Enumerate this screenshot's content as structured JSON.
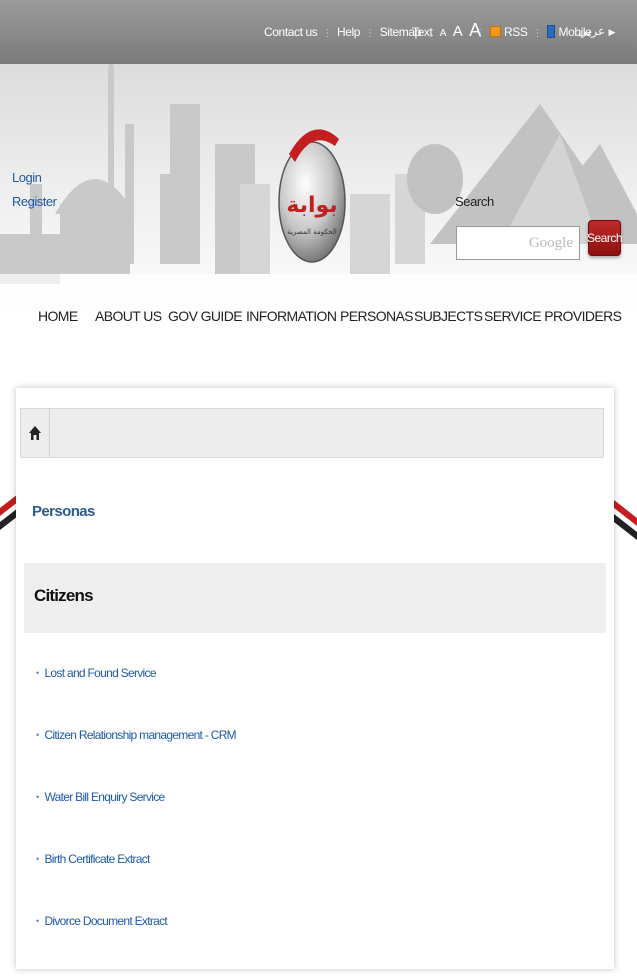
{
  "topbar": {
    "contact": "Contact us",
    "help": "Help",
    "sitemap": "Sitemap",
    "text_label": "Text",
    "text_sizes": [
      "A",
      "A",
      "A"
    ],
    "rss": "RSS",
    "mobile": "Mobile",
    "arabic": "عربي"
  },
  "header": {
    "login": "Login",
    "register": "Register",
    "logo_text": "بوابة",
    "logo_sub": "الحكومة المصرية",
    "search_label": "Search",
    "search_placeholder": "Google",
    "search_button": "Search"
  },
  "nav": {
    "items": [
      "HOME",
      "ABOUT US",
      "GOV GUIDE",
      "INFORMATION",
      "PERSONAS",
      "SUBJECTS",
      "SERVICE PROVIDERS"
    ]
  },
  "content": {
    "parent_link": "Personas",
    "section_title": "Citizens",
    "services": [
      "Lost and Found Service",
      "Citizen Relationship management - CRM",
      "Water Bill Enquiry Service",
      "Birth Certificate Extract",
      "Divorce Document Extract"
    ]
  },
  "colors": {
    "topbar": "#8a8a8a",
    "link": "#1e5aa8",
    "search_button": "#a81c1c"
  }
}
